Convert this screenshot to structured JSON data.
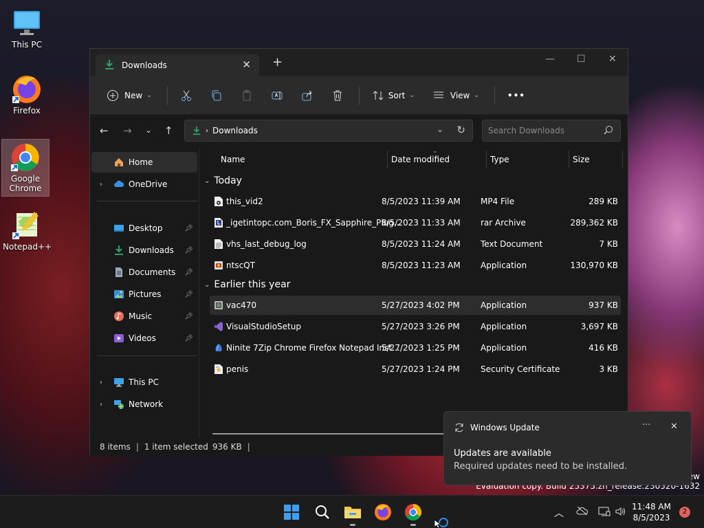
{
  "desktop": {
    "icons": [
      {
        "label": "This PC"
      },
      {
        "label": "Firefox"
      },
      {
        "label": "Google Chrome"
      },
      {
        "label": "Notepad++"
      }
    ]
  },
  "explorer": {
    "tab_title": "Downloads",
    "toolbar": {
      "new_label": "New",
      "sort_label": "Sort",
      "view_label": "View",
      "more_label": "•••"
    },
    "address": {
      "path": "Downloads",
      "search_placeholder": "Search Downloads"
    },
    "sidebar": {
      "items": [
        {
          "label": "Home"
        },
        {
          "label": "OneDrive"
        },
        {
          "label": "Desktop"
        },
        {
          "label": "Downloads"
        },
        {
          "label": "Documents"
        },
        {
          "label": "Pictures"
        },
        {
          "label": "Music"
        },
        {
          "label": "Videos"
        },
        {
          "label": "This PC"
        },
        {
          "label": "Network"
        }
      ]
    },
    "columns": {
      "name": "Name",
      "date": "Date modified",
      "type": "Type",
      "size": "Size"
    },
    "groups": [
      {
        "label": "Today",
        "files": [
          {
            "name": "this_vid2",
            "date": "8/5/2023 11:39 AM",
            "type": "MP4 File",
            "size": "289 KB"
          },
          {
            "name": "_igetintopc.com_Boris_FX_Sapphire_Plug...",
            "date": "8/5/2023 11:33 AM",
            "type": "rar Archive",
            "size": "289,362 KB"
          },
          {
            "name": "vhs_last_debug_log",
            "date": "8/5/2023 11:24 AM",
            "type": "Text Document",
            "size": "7 KB"
          },
          {
            "name": "ntscQT",
            "date": "8/5/2023 11:23 AM",
            "type": "Application",
            "size": "130,970 KB"
          }
        ]
      },
      {
        "label": "Earlier this year",
        "files": [
          {
            "name": "vac470",
            "date": "5/27/2023 4:02 PM",
            "type": "Application",
            "size": "937 KB"
          },
          {
            "name": "VisualStudioSetup",
            "date": "5/27/2023 3:26 PM",
            "type": "Application",
            "size": "3,697 KB"
          },
          {
            "name": "Ninite 7Zip Chrome Firefox Notepad Inst...",
            "date": "5/27/2023 1:25 PM",
            "type": "Application",
            "size": "416 KB"
          },
          {
            "name": "penis",
            "date": "5/27/2023 1:24 PM",
            "type": "Security Certificate",
            "size": "3 KB"
          }
        ]
      }
    ],
    "status": {
      "count": "8 items",
      "selection": "1 item selected",
      "selection_size": "936 KB"
    }
  },
  "notification": {
    "app": "Windows Update",
    "title": "Updates are available",
    "body": "Required updates need to be installed."
  },
  "watermark": {
    "line1": "ew",
    "line2": "Evaluation copy. Build 25375.zn_release.230520-1632"
  },
  "taskbar": {
    "time": "11:48 AM",
    "date": "8/5/2023",
    "badge": "2"
  },
  "colors": {
    "accent": "#2ca36b",
    "folder_yellow": "#f3c74d",
    "window_bg": "#191919",
    "toolbar_bg": "#2b2b2b"
  }
}
